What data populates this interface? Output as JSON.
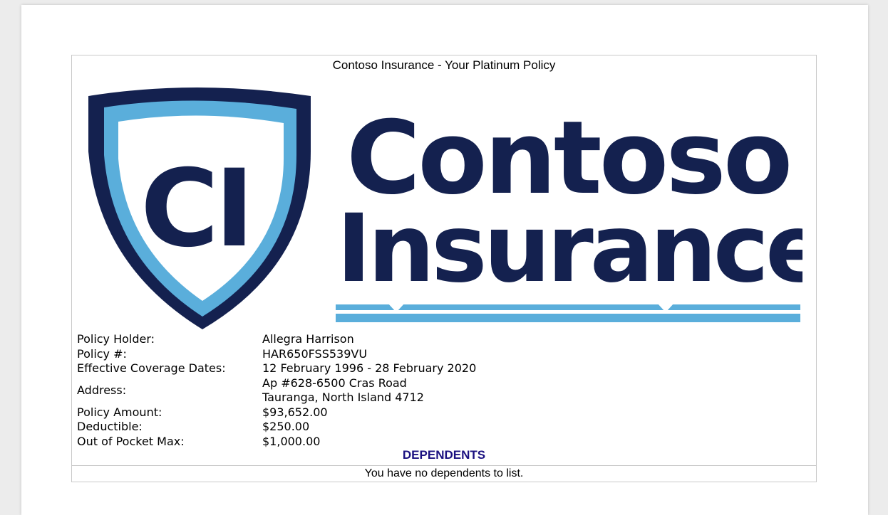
{
  "document": {
    "title": "Contoso Insurance - Your Platinum Policy"
  },
  "logo": {
    "monogram": "CI",
    "brand_line1": "Contoso",
    "brand_line2": "Insurance",
    "colors": {
      "navy": "#14214f",
      "sky": "#5aaedb"
    }
  },
  "policy": {
    "holder_label": "Policy Holder:",
    "holder_value": "Allegra Harrison",
    "number_label": "Policy #:",
    "number_value": "HAR650FSS539VU",
    "dates_label": "Effective Coverage Dates:",
    "dates_value": "12 February 1996 - 28 February 2020",
    "address_label": "Address:",
    "address_line1": "Ap #628-6500 Cras Road",
    "address_line2": "Tauranga, North Island 4712",
    "amount_label": "Policy Amount:",
    "amount_value": "$93,652.00",
    "deductible_label": "Deductible:",
    "deductible_value": "$250.00",
    "oop_label": "Out of Pocket Max:",
    "oop_value": "$1,000.00"
  },
  "dependents": {
    "heading": "DEPENDENTS",
    "empty_message": "You have no dependents to list."
  }
}
